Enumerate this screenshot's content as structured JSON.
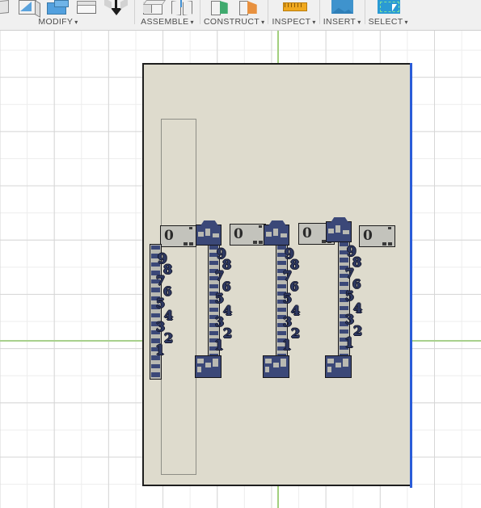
{
  "app": {
    "name": "Fusion 360 CAD viewport",
    "background_color": "#ffffff",
    "grid_minor_color": "#ededed",
    "grid_major_color": "#d6d6d6"
  },
  "toolbar": {
    "groups": [
      {
        "label": "MODIFY",
        "dropdown_caret": "▾",
        "icons": [
          "press-pull-icon",
          "fillet-icon",
          "shell-icon",
          "draft-icon",
          "scale-icon",
          "move-copy-icon"
        ]
      },
      {
        "label": "ASSEMBLE",
        "dropdown_caret": "▾",
        "icons": [
          "new-component-icon",
          "joint-icon"
        ]
      },
      {
        "label": "CONSTRUCT",
        "dropdown_caret": "▾",
        "icons": [
          "offset-plane-icon",
          "plane-at-angle-icon"
        ]
      },
      {
        "label": "INSPECT",
        "dropdown_caret": "▾",
        "icons": [
          "measure-icon"
        ]
      },
      {
        "label": "INSERT",
        "dropdown_caret": "▾",
        "icons": [
          "insert-mcmaster-icon"
        ]
      },
      {
        "label": "SELECT",
        "dropdown_caret": "▾",
        "icons": [
          "select-window-icon"
        ]
      }
    ]
  },
  "viewport": {
    "axis_h_color": "#a8d18d",
    "axis_v_color": "#a2cf7d",
    "highlight_edge_color": "#2a5cd8",
    "board": {
      "name": "base-plate",
      "fill_color": "#dedbcd",
      "edge_color": "#1e1e1e",
      "slot": {
        "name": "rectangular-slot",
        "edge_color": "#8e8e86"
      }
    },
    "zero_tiles": [
      {
        "label": "0"
      },
      {
        "label": "0"
      },
      {
        "label": "0"
      },
      {
        "label": "0"
      }
    ],
    "ladders": [
      {
        "name": "ladder-1",
        "style": "plain",
        "rung_color": "#3b4878",
        "body_color": "#b9b9b2",
        "digits": [
          "9",
          "8",
          "7",
          "6",
          "5",
          "4",
          "3",
          "2",
          "1"
        ]
      },
      {
        "name": "ladder-2",
        "style": "capped",
        "rung_color": "#3b4878",
        "body_color": "#b9b9b2",
        "digits": [
          "9",
          "8",
          "7",
          "6",
          "5",
          "4",
          "3",
          "2",
          "1"
        ]
      },
      {
        "name": "ladder-3",
        "style": "capped",
        "rung_color": "#3b4878",
        "body_color": "#b9b9b2",
        "digits": [
          "9",
          "8",
          "7",
          "6",
          "5",
          "4",
          "3",
          "2",
          "1"
        ]
      },
      {
        "name": "ladder-4",
        "style": "capped",
        "rung_color": "#3b4878",
        "body_color": "#b9b9b2",
        "digits": [
          "9",
          "8",
          "7",
          "6",
          "5",
          "4",
          "3",
          "2",
          "1"
        ]
      }
    ]
  }
}
